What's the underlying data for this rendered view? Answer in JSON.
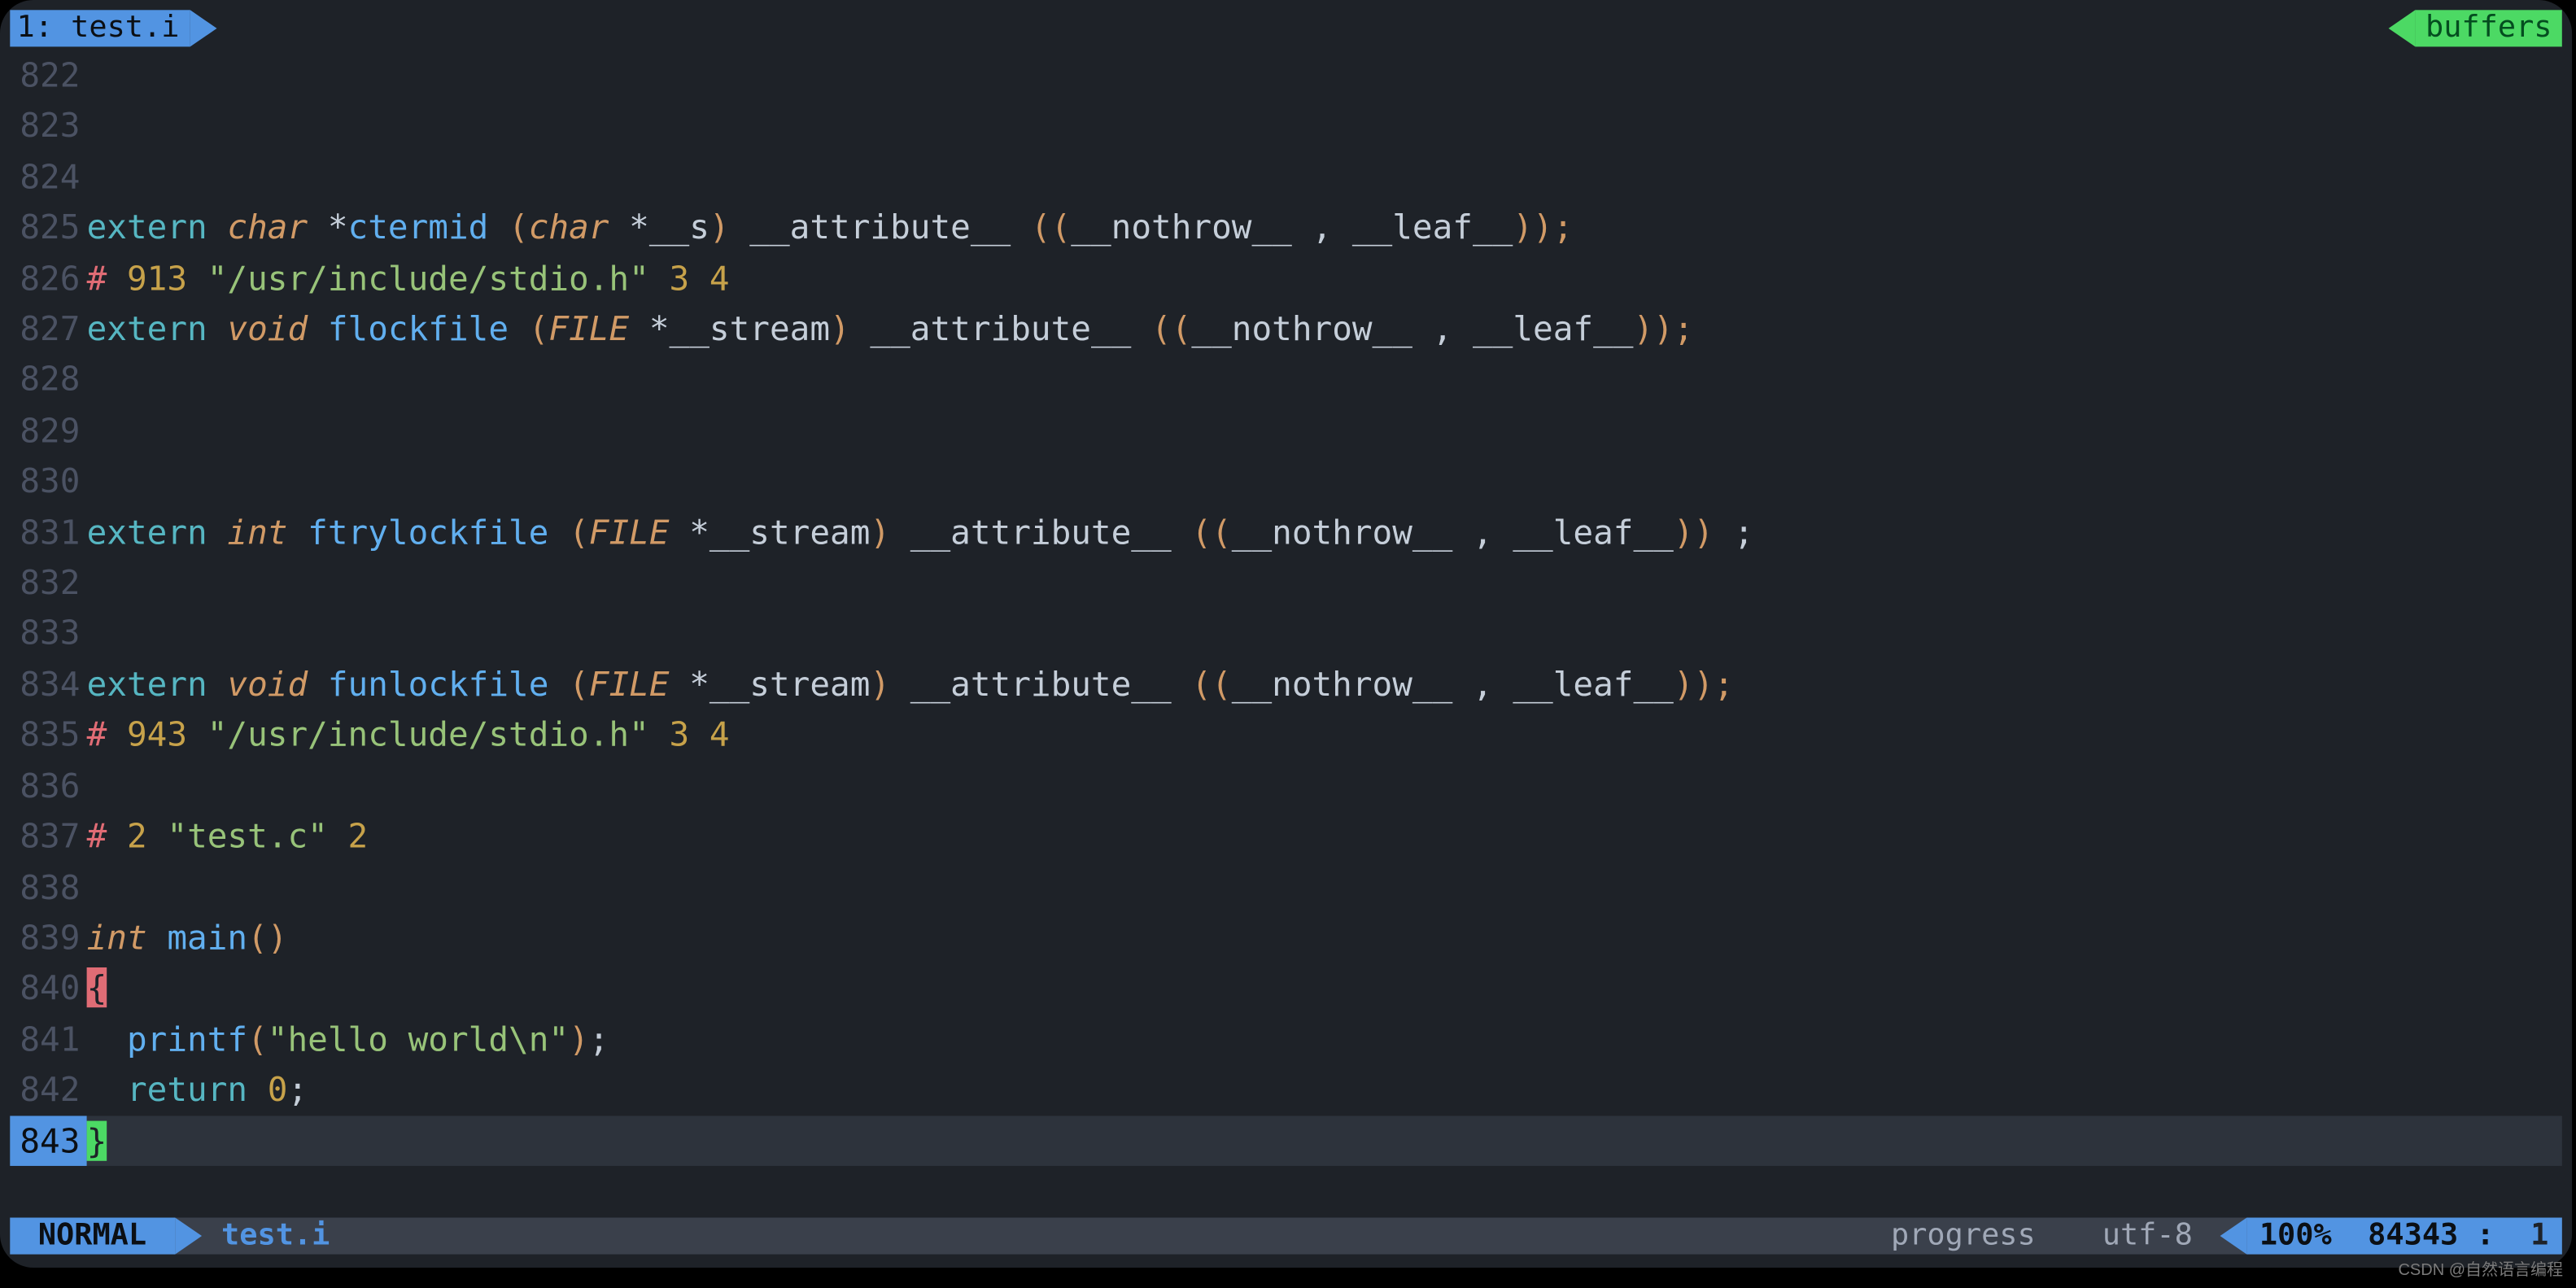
{
  "tab_left": " 1: test.i ",
  "tab_right": " buffers ",
  "lines": [
    {
      "n": "822",
      "tokens": []
    },
    {
      "n": "823",
      "tokens": []
    },
    {
      "n": "824",
      "tokens": []
    },
    {
      "n": "825",
      "tokens": [
        {
          "c": "kw-teal",
          "t": "extern "
        },
        {
          "c": "char",
          "t": "char "
        },
        {
          "c": "",
          "t": "*"
        },
        {
          "c": "fn-blue",
          "t": "ctermid "
        },
        {
          "c": "paren",
          "t": "("
        },
        {
          "c": "char",
          "t": "char "
        },
        {
          "c": "",
          "t": "*__s"
        },
        {
          "c": "paren",
          "t": ")"
        },
        {
          "c": "",
          "t": " __attribute__ "
        },
        {
          "c": "paren",
          "t": "(("
        },
        {
          "c": "",
          "t": "__nothrow__ , __leaf__"
        },
        {
          "c": "paren",
          "t": "));"
        }
      ]
    },
    {
      "n": "826",
      "tokens": [
        {
          "c": "red",
          "t": "# "
        },
        {
          "c": "num",
          "t": "913 "
        },
        {
          "c": "str",
          "t": "\"/usr/include/stdio.h\""
        },
        {
          "c": "num",
          "t": " 3 4"
        }
      ]
    },
    {
      "n": "827",
      "tokens": [
        {
          "c": "kw-teal",
          "t": "extern "
        },
        {
          "c": "void",
          "t": "void "
        },
        {
          "c": "fn-blue",
          "t": "flockfile "
        },
        {
          "c": "paren",
          "t": "("
        },
        {
          "c": "kw-orange",
          "t": "FILE "
        },
        {
          "c": "",
          "t": "*__stream"
        },
        {
          "c": "paren",
          "t": ")"
        },
        {
          "c": "",
          "t": " __attribute__ "
        },
        {
          "c": "paren",
          "t": "(("
        },
        {
          "c": "",
          "t": "__nothrow__ , __leaf__"
        },
        {
          "c": "paren",
          "t": "));"
        }
      ]
    },
    {
      "n": "828",
      "tokens": []
    },
    {
      "n": "829",
      "tokens": []
    },
    {
      "n": "830",
      "tokens": []
    },
    {
      "n": "831",
      "tokens": [
        {
          "c": "kw-teal",
          "t": "extern "
        },
        {
          "c": "int",
          "t": "int "
        },
        {
          "c": "fn-blue",
          "t": "ftrylockfile "
        },
        {
          "c": "paren",
          "t": "("
        },
        {
          "c": "kw-orange",
          "t": "FILE "
        },
        {
          "c": "",
          "t": "*__stream"
        },
        {
          "c": "paren",
          "t": ")"
        },
        {
          "c": "",
          "t": " __attribute__ "
        },
        {
          "c": "paren",
          "t": "(("
        },
        {
          "c": "",
          "t": "__nothrow__ , __leaf__"
        },
        {
          "c": "paren",
          "t": "))"
        },
        {
          "c": "",
          "t": " ;"
        }
      ]
    },
    {
      "n": "832",
      "tokens": []
    },
    {
      "n": "833",
      "tokens": []
    },
    {
      "n": "834",
      "tokens": [
        {
          "c": "kw-teal",
          "t": "extern "
        },
        {
          "c": "void",
          "t": "void "
        },
        {
          "c": "fn-blue",
          "t": "funlockfile "
        },
        {
          "c": "paren",
          "t": "("
        },
        {
          "c": "kw-orange",
          "t": "FILE "
        },
        {
          "c": "",
          "t": "*__stream"
        },
        {
          "c": "paren",
          "t": ")"
        },
        {
          "c": "",
          "t": " __attribute__ "
        },
        {
          "c": "paren",
          "t": "(("
        },
        {
          "c": "",
          "t": "__nothrow__ , __leaf__"
        },
        {
          "c": "paren",
          "t": "));"
        }
      ]
    },
    {
      "n": "835",
      "tokens": [
        {
          "c": "red",
          "t": "# "
        },
        {
          "c": "num",
          "t": "943 "
        },
        {
          "c": "str",
          "t": "\"/usr/include/stdio.h\""
        },
        {
          "c": "num",
          "t": " 3 4"
        }
      ]
    },
    {
      "n": "836",
      "tokens": []
    },
    {
      "n": "837",
      "tokens": [
        {
          "c": "red",
          "t": "# "
        },
        {
          "c": "num",
          "t": "2 "
        },
        {
          "c": "str",
          "t": "\"test.c\""
        },
        {
          "c": "num",
          "t": " 2"
        }
      ]
    },
    {
      "n": "838",
      "tokens": []
    },
    {
      "n": "839",
      "tokens": [
        {
          "c": "int",
          "t": "int "
        },
        {
          "c": "fn-blue",
          "t": "main"
        },
        {
          "c": "paren",
          "t": "()"
        }
      ]
    },
    {
      "n": "840",
      "match": true,
      "tokens": [
        {
          "c": "brace-open",
          "t": "{"
        }
      ]
    },
    {
      "n": "841",
      "tokens": [
        {
          "c": "",
          "t": "  "
        },
        {
          "c": "fn-blue",
          "t": "printf"
        },
        {
          "c": "paren",
          "t": "("
        },
        {
          "c": "str",
          "t": "\"hello world\\n\""
        },
        {
          "c": "paren",
          "t": ")"
        },
        {
          "c": "",
          "t": ";"
        }
      ]
    },
    {
      "n": "842",
      "tokens": [
        {
          "c": "",
          "t": "  "
        },
        {
          "c": "kw-teal",
          "t": "return "
        },
        {
          "c": "num",
          "t": "0"
        },
        {
          "c": "",
          "t": ";"
        }
      ]
    },
    {
      "n": "843",
      "current": true,
      "tokens": [
        {
          "c": "brace-close cursor-block",
          "t": "}"
        }
      ]
    }
  ],
  "status": {
    "mode": " NORMAL ",
    "file": "test.i",
    "progress": "progress",
    "encoding": "utf-8",
    "percent": "100%",
    "line": "84343",
    "sep": ":",
    "col": "1"
  },
  "watermark": "CSDN @自然语言编程"
}
